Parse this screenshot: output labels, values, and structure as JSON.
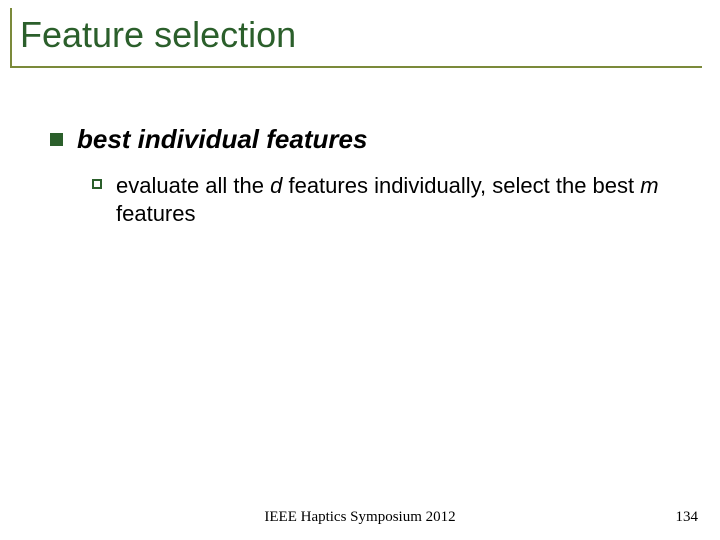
{
  "title": "Feature selection",
  "level1": {
    "text": "best individual features"
  },
  "level2": {
    "pre": "evaluate all the ",
    "d": "d",
    "mid": " features individually, select the best ",
    "m": "m",
    "post": " features"
  },
  "footer": "IEEE Haptics Symposium 2012",
  "page": "134"
}
